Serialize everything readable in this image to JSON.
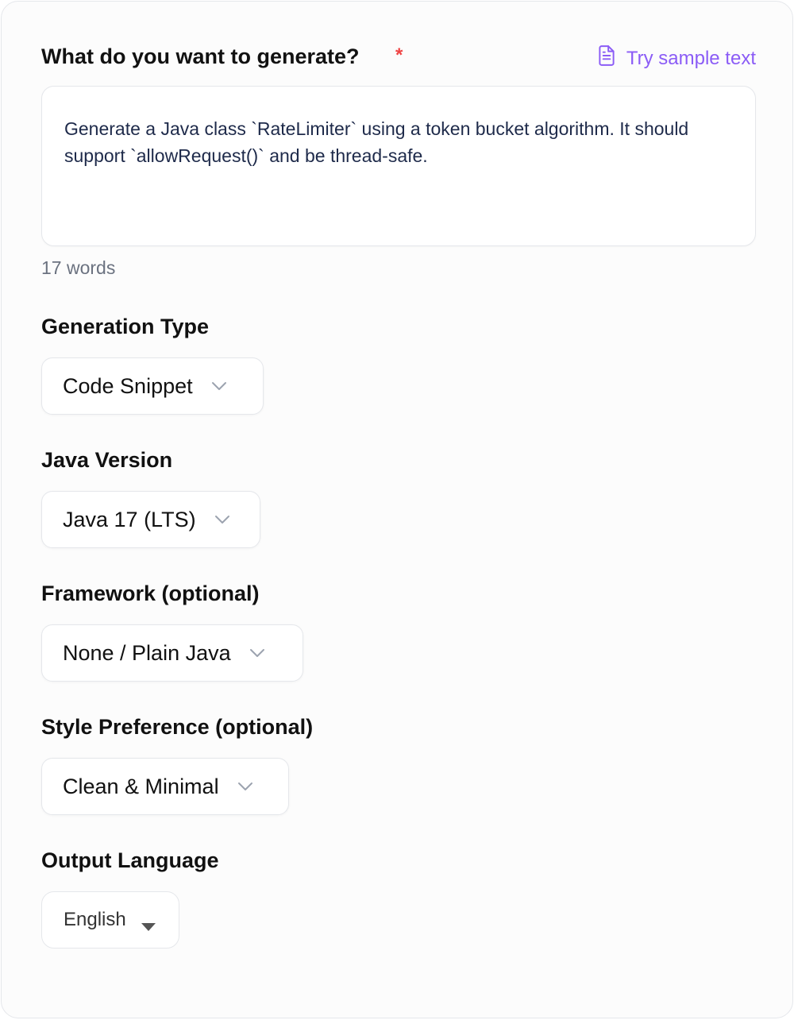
{
  "prompt": {
    "label": "What do you want to generate?",
    "required_mark": "*",
    "sample_link_label": "Try sample text",
    "value": "Generate a Java class `RateLimiter` using a token bucket algorithm. It should support `allowRequest()` and be thread-safe.",
    "word_count": "17 words"
  },
  "generation_type": {
    "label": "Generation Type",
    "selected": "Code Snippet"
  },
  "java_version": {
    "label": "Java Version",
    "selected": "Java 17 (LTS)"
  },
  "framework": {
    "label": "Framework (optional)",
    "selected": "None / Plain Java"
  },
  "style_preference": {
    "label": "Style Preference (optional)",
    "selected": "Clean & Minimal"
  },
  "output_language": {
    "label": "Output Language",
    "selected": "English"
  },
  "colors": {
    "accent": "#8b5cf6",
    "required": "#ef4444",
    "border": "#e5e7eb",
    "text": "#111111",
    "muted": "#6b7280"
  },
  "icons": {
    "sample_link": "document-icon",
    "select": "chevron-down-icon",
    "language_select": "caret-down-icon"
  }
}
